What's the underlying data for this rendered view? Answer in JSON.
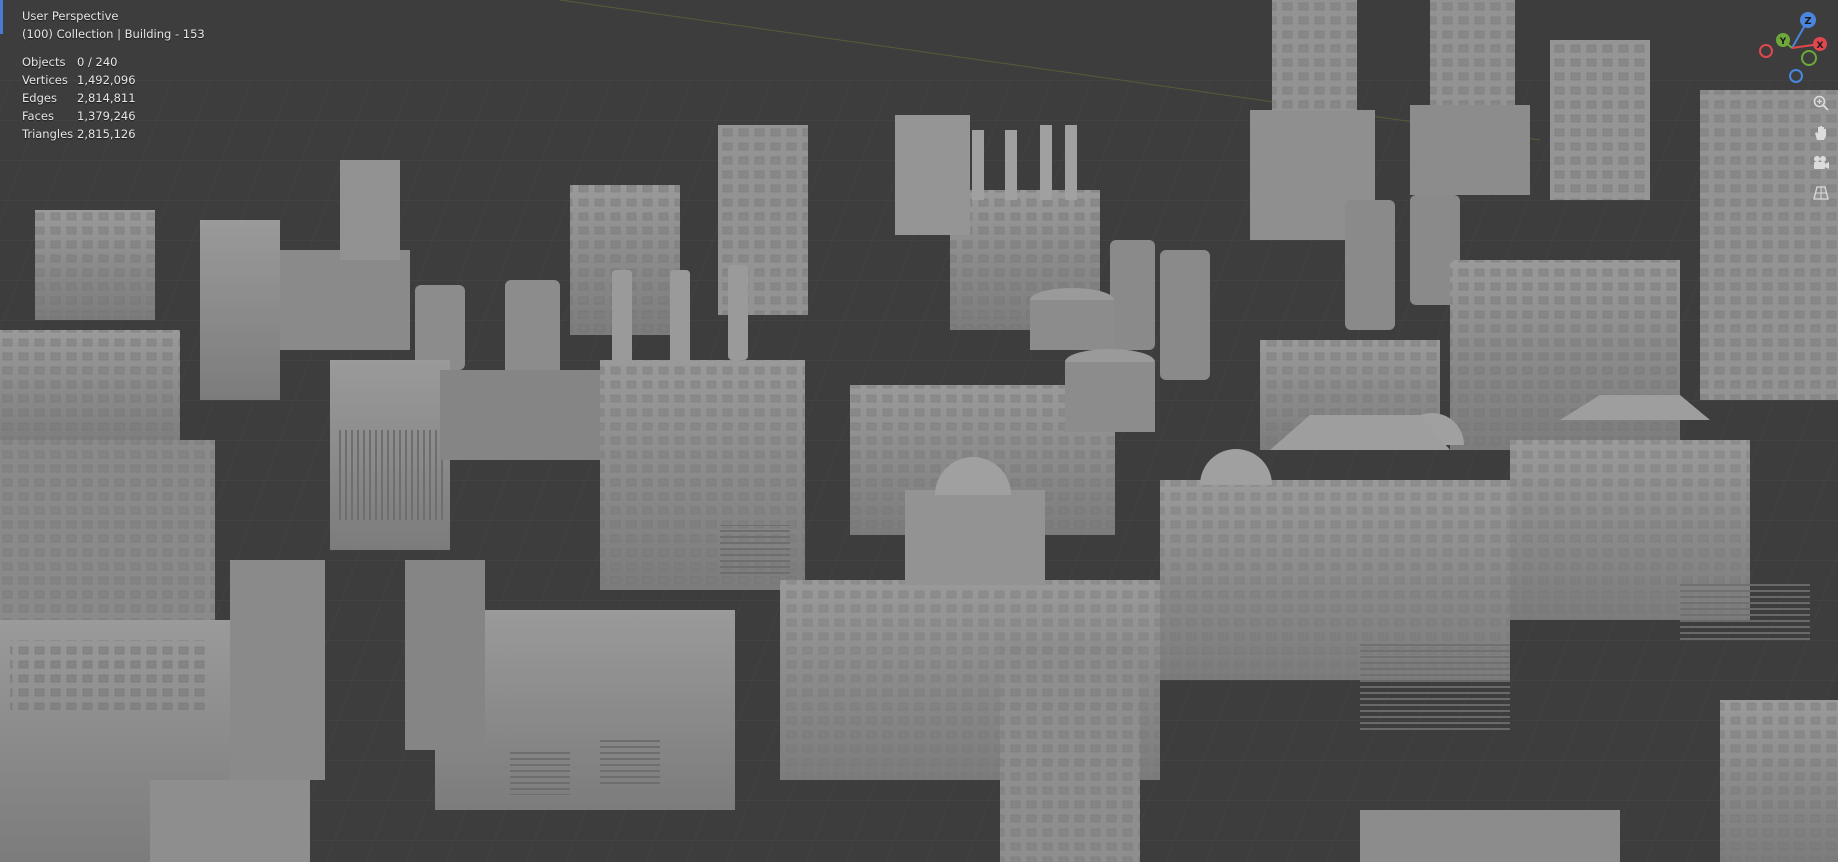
{
  "viewport": {
    "mode": "User Perspective",
    "collection_line": "(100) Collection | Building - 153",
    "stats": [
      {
        "label": "Objects",
        "value": "0 / 240"
      },
      {
        "label": "Vertices",
        "value": "1,492,096"
      },
      {
        "label": "Edges",
        "value": "2,814,811"
      },
      {
        "label": "Faces",
        "value": "1,379,246"
      },
      {
        "label": "Triangles",
        "value": "2,815,126"
      }
    ]
  },
  "gizmo": {
    "axes": [
      "Z",
      "Y",
      "X"
    ],
    "colors": {
      "x": "#e0474f",
      "y": "#6fa83a",
      "z": "#4a86e0"
    }
  },
  "nav_buttons": [
    "zoom-icon",
    "hand-pan-icon",
    "camera-icon",
    "grid-perspective-icon"
  ],
  "colors": {
    "background": "#3d3d3d",
    "grid": "#4a4a4a",
    "building": "#8e8e8e",
    "text": "#e6e6e6"
  }
}
